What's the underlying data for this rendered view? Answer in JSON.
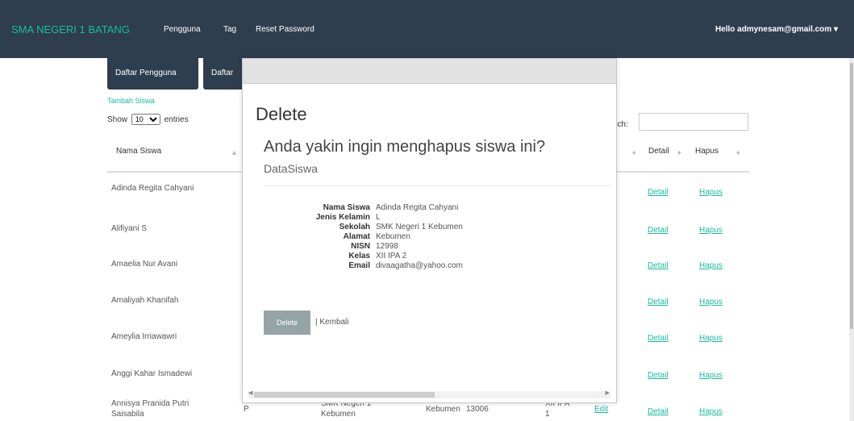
{
  "navbar": {
    "brand": "SMA NEGERI 1 BATANG",
    "links": [
      "Pengguna",
      "Tag",
      "Reset Password"
    ],
    "user": "Hello admynesam@gmail.com",
    "user_caret": "▾"
  },
  "tabs": [
    "Daftar Pengguna",
    "Daftar"
  ],
  "add_link": "Tambah Siswa",
  "show": {
    "prefix": "Show",
    "value": "10",
    "suffix": "entries"
  },
  "search": {
    "label": "rch:"
  },
  "table": {
    "headers": {
      "name": "Nama Siswa",
      "detail": "Detail",
      "hapus": "Hapus"
    },
    "rows": [
      {
        "name": "Adinda Regita Cahyani",
        "detail": "Detail",
        "hapus": "Hapus"
      },
      {
        "name": "Alifiyani S",
        "detail": "Detail",
        "hapus": "Hapus"
      },
      {
        "name": "Amaelia Nur Avani",
        "detail": "Detail",
        "hapus": "Hapus"
      },
      {
        "name": "Amaliyah Khanifah",
        "detail": "Detail",
        "hapus": "Hapus"
      },
      {
        "name": "Ameylia Irriawawri",
        "detail": "Detail",
        "hapus": "Hapus"
      },
      {
        "name": "Anggi Kahar Ismadewi",
        "detail": "Detail",
        "hapus": "Hapus"
      },
      {
        "name": "Annisya Pranida Putri",
        "name2": "Saisabila",
        "jk": "P",
        "sekolah": "SMK Negeri 1",
        "sekolah2": "Kebumen",
        "alamat": "Kebumen",
        "nisn": "13006",
        "kelas": "XII IPA",
        "kelas2": "1",
        "edit": "Edit",
        "detail": "Detail",
        "hapus": "Hapus"
      }
    ]
  },
  "modal": {
    "title": "Delete",
    "question": "Anda yakin ingin menghapus siswa ini?",
    "subtitle": "DataSiswa",
    "fields": [
      {
        "label": "Nama Siswa",
        "value": "Adinda Regita Cahyani"
      },
      {
        "label": "Jenis Kelamin",
        "value": "L"
      },
      {
        "label": "Sekolah",
        "value": "SMK Negeri 1 Kebumen"
      },
      {
        "label": "Alamat",
        "value": "Kebumen"
      },
      {
        "label": "NISN",
        "value": "12998"
      },
      {
        "label": "Kelas",
        "value": "XII IPA 2"
      },
      {
        "label": "Email",
        "value": "divaagatha@yahoo.com"
      }
    ],
    "delete_label": "Delete",
    "back_label": "| Kembali"
  },
  "colors": {
    "navbar": "#2f3e4f",
    "accent": "#18bc9c",
    "button_disabled": "#95a5a6"
  }
}
